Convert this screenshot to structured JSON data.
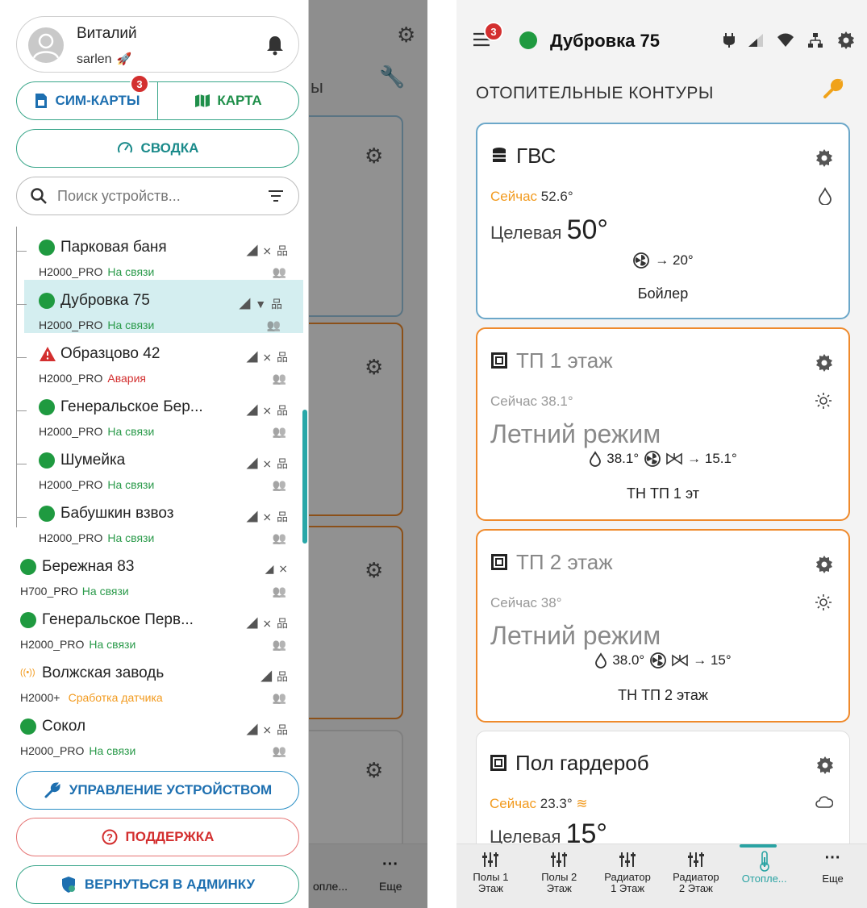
{
  "left": {
    "user": {
      "name": "Виталий",
      "login": "sarlen"
    },
    "seg": {
      "sim_label": "СИМ-КАРТЫ",
      "sim_badge": "3",
      "map_label": "КАРТА"
    },
    "summary_label": "СВОДКА",
    "search": {
      "placeholder": "Поиск устройств..."
    },
    "devices": [
      {
        "name": "Парковая баня",
        "model": "H2000_PRO",
        "status": "На связи",
        "status_color": "#2a9a4a",
        "icon": "online-dot",
        "nested": true
      },
      {
        "name": "Дубровка 75",
        "model": "H2000_PRO",
        "status": "На связи",
        "status_color": "#2a9a4a",
        "icon": "online-dot",
        "nested": true,
        "selected": true
      },
      {
        "name": "Образцово 42",
        "model": "H2000_PRO",
        "status": "Авария",
        "status_color": "#d32f2f",
        "icon": "alert-icon",
        "nested": true
      },
      {
        "name": "Генеральское Бер...",
        "model": "H2000_PRO",
        "status": "На связи",
        "status_color": "#2a9a4a",
        "icon": "online-dot",
        "nested": true
      },
      {
        "name": "Шумейка",
        "model": "H2000_PRO",
        "status": "На связи",
        "status_color": "#2a9a4a",
        "icon": "online-dot",
        "nested": true
      },
      {
        "name": "Бабушкин взвоз",
        "model": "H2000_PRO",
        "status": "На связи",
        "status_color": "#2a9a4a",
        "icon": "online-dot",
        "nested": true
      },
      {
        "name": "Бережная 83",
        "model": "H700_PRO",
        "status": "На связи",
        "status_color": "#2a9a4a",
        "icon": "online-dot",
        "nested": false
      },
      {
        "name": "Генеральское Перв...",
        "model": "H2000_PRO",
        "status": "На связи",
        "status_color": "#2a9a4a",
        "icon": "online-dot",
        "nested": false
      },
      {
        "name": "Волжская заводь",
        "model": "H2000+",
        "status": "Сработка датчика",
        "status_color": "#f29a1e",
        "icon": "sensor-icon",
        "nested": false
      },
      {
        "name": "Сокол",
        "model": "H2000_PRO",
        "status": "На связи",
        "status_color": "#2a9a4a",
        "icon": "online-dot",
        "nested": false
      }
    ],
    "manage_label": "УПРАВЛЕНИЕ УСТРОЙСТВОМ",
    "support_label": "ПОДДЕРЖКА",
    "admin_label": "ВЕРНУТЬСЯ В АДМИНКУ",
    "bg": {
      "partial_title": "ы",
      "partial_tab": "опле...",
      "more": "Еще"
    }
  },
  "right": {
    "menu_badge": "3",
    "title": "Дубровка 75",
    "section_title": "ОТОПИТЕЛЬНЫЕ КОНТУРЫ",
    "cards": [
      {
        "name": "ГВС",
        "now_label": "Сейчас",
        "now_value": "52.6°",
        "target_label": "Целевая",
        "target_value": "50°",
        "flow": "→ 20°",
        "sub": "Бойлер"
      },
      {
        "name": "ТП 1 этаж",
        "now_label": "Сейчас",
        "now_value": "38.1°",
        "mode": "Летний режим",
        "flow_temp": "38.1°",
        "flow": "→ 15.1°",
        "sub": "ТН ТП 1 эт"
      },
      {
        "name": "ТП 2 этаж",
        "now_label": "Сейчас",
        "now_value": "38°",
        "mode": "Летний режим",
        "flow_temp": "38.0°",
        "flow": "→ 15°",
        "sub": "ТН ТП 2 этаж"
      },
      {
        "name": "Пол гардероб",
        "now_label": "Сейчас",
        "now_value": "23.3°",
        "target_label": "Целевая",
        "target_value": "15°"
      }
    ],
    "tabs": [
      {
        "label1": "Полы 1",
        "label2": "Этаж"
      },
      {
        "label1": "Полы 2",
        "label2": "Этаж"
      },
      {
        "label1": "Радиатор",
        "label2": "1 Этаж"
      },
      {
        "label1": "Радиатор",
        "label2": "2 Этаж"
      },
      {
        "label1": "Отопле...",
        "label2": ""
      },
      {
        "label1": "Еще",
        "label2": ""
      }
    ]
  }
}
